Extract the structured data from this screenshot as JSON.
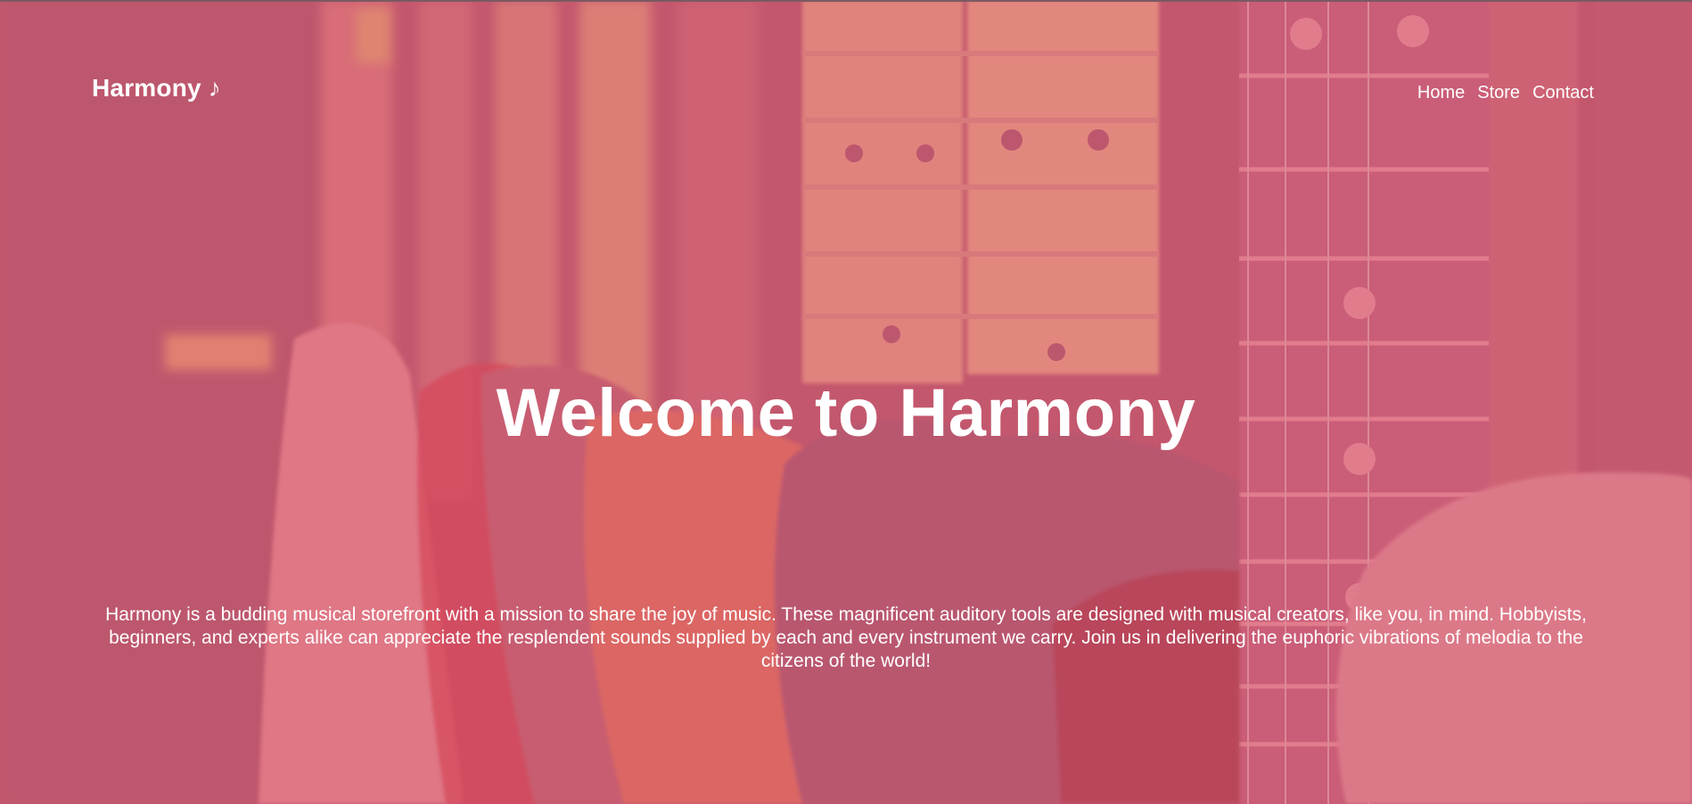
{
  "header": {
    "logo": "Harmony ♪",
    "nav": [
      {
        "label": "Home"
      },
      {
        "label": "Store"
      },
      {
        "label": "Contact"
      }
    ]
  },
  "hero": {
    "title": "Welcome to Harmony",
    "description": "Harmony is a budding musical storefront with a mission to share the joy of music. These magnificent auditory tools are designed with musical creators, like you, in mind. Hobbyists, beginners, and experts alike can appreciate the resplendent sounds supplied by each and every instrument we carry. Join us in delivering the euphoric vibrations of melodia to the citizens of the world!",
    "background_image": "guitars-photo",
    "overlay_color": "#d65a73"
  }
}
